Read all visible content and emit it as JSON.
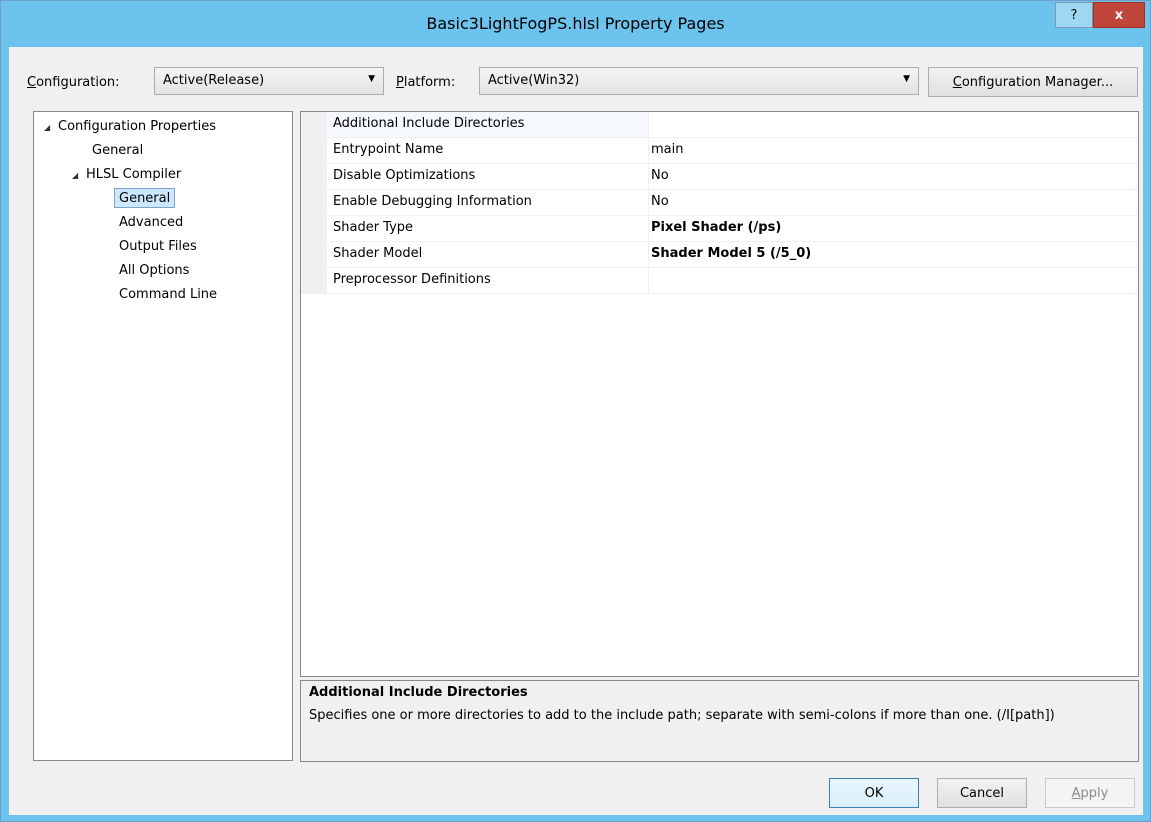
{
  "window": {
    "title": "Basic3LightFogPS.hlsl Property Pages",
    "help_glyph": "?",
    "close_glyph": "x"
  },
  "toolbar": {
    "configuration_label_pre": "",
    "configuration_label_key": "C",
    "configuration_label_post": "onfiguration:",
    "configuration_value": "Active(Release)",
    "platform_label_key": "P",
    "platform_label_post": "latform:",
    "platform_value": "Active(Win32)",
    "config_manager_key": "C",
    "config_manager_post": "onfiguration Manager..."
  },
  "tree": {
    "items": [
      {
        "label": "Configuration Properties"
      },
      {
        "label": "General"
      },
      {
        "label": "HLSL Compiler"
      },
      {
        "label": "General"
      },
      {
        "label": "Advanced"
      },
      {
        "label": "Output Files"
      },
      {
        "label": "All Options"
      },
      {
        "label": "Command Line"
      }
    ]
  },
  "properties": {
    "rows": [
      {
        "name": "Additional Include Directories",
        "value": ""
      },
      {
        "name": "Entrypoint Name",
        "value": "main"
      },
      {
        "name": "Disable Optimizations",
        "value": "No"
      },
      {
        "name": "Enable Debugging Information",
        "value": "No"
      },
      {
        "name": "Shader Type",
        "value": "Pixel Shader (/ps)"
      },
      {
        "name": "Shader Model",
        "value": "Shader Model 5 (/5_0)"
      },
      {
        "name": "Preprocessor Definitions",
        "value": ""
      }
    ]
  },
  "description": {
    "title": "Additional Include Directories",
    "text": "Specifies one or more directories to add to the include path; separate with semi-colons if more than one. (/I[path])"
  },
  "buttons": {
    "ok": "OK",
    "cancel": "Cancel",
    "apply_key": "A",
    "apply_post": "pply"
  },
  "colors": {
    "titlebar": "#6cc3ed",
    "selection": "#cce8ff",
    "close": "#c0463b"
  }
}
